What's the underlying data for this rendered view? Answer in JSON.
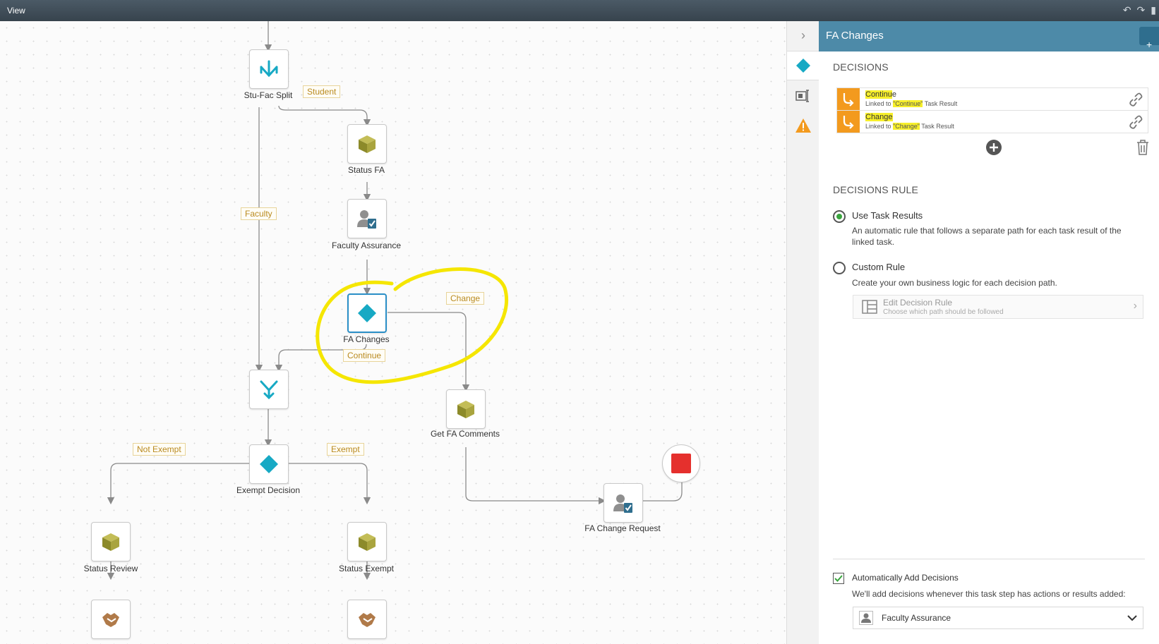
{
  "topbar": {
    "view_label": "View"
  },
  "canvas": {
    "nodes": {
      "stu_fac_split": "Stu-Fac Split",
      "status_fa": "Status FA",
      "faculty_assurance": "Faculty Assurance",
      "fa_changes": "FA Changes",
      "get_fa_comments": "Get FA Comments",
      "exempt_decision": "Exempt Decision",
      "status_review": "Status Review",
      "status_exempt": "Status Exempt",
      "fa_change_request": "FA Change Request"
    },
    "edges": {
      "student": "Student",
      "faculty": "Faculty",
      "change": "Change",
      "continue": "Continue",
      "not_exempt": "Not Exempt",
      "exempt": "Exempt"
    }
  },
  "panel": {
    "title": "FA Changes",
    "decisions_header": "DECISIONS",
    "decisions": [
      {
        "name_hl": "Continu",
        "name_rest": "e",
        "linked_prefix": "Linked to ",
        "linked_value": "\"Continue\"",
        "linked_suffix": " Task Result"
      },
      {
        "name_hl": "Change",
        "name_rest": "",
        "linked_prefix": "Linked to ",
        "linked_value": "\"Change\"",
        "linked_suffix": " Task Result"
      }
    ],
    "rule_header": "DECISIONS RULE",
    "rule_options": [
      {
        "title": "Use Task Results",
        "desc": "An automatic rule that follows a separate path for each task result of the linked task.",
        "selected": true
      },
      {
        "title": "Custom Rule",
        "desc": "Create your own business logic for each decision path.",
        "selected": false
      }
    ],
    "edit_rule": {
      "title": "Edit Decision Rule",
      "subtitle": "Choose which path should be followed"
    },
    "auto_add": {
      "label": "Automatically Add Decisions",
      "desc": "We'll add decisions whenever this task step has actions or results added:",
      "checked": true
    },
    "linked_task": "Faculty Assurance"
  },
  "colors": {
    "accent_teal": "#17a9c4",
    "header_blue": "#4d8aa8",
    "decision_orange": "#f39a1e",
    "highlight_yellow": "#f7ef2a",
    "end_red": "#e5302d"
  }
}
